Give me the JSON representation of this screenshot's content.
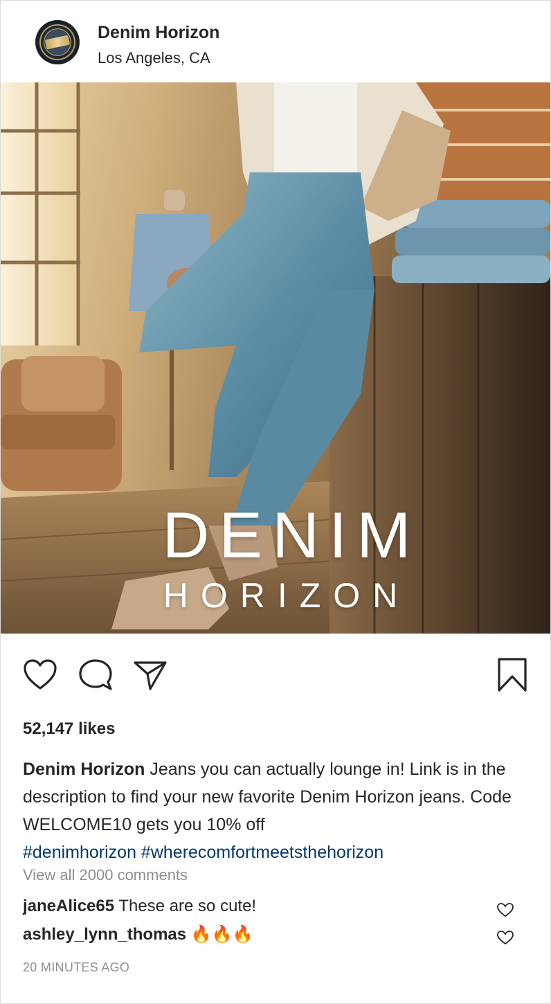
{
  "post": {
    "username": "Denim Horizon",
    "location": "Los Angeles, CA",
    "image": {
      "brand_line1": "DENIM",
      "brand_line2": "HORIZON"
    },
    "icons": [
      "heart-icon",
      "comment-icon",
      "share-icon",
      "bookmark-icon"
    ],
    "likes": "52,147 likes",
    "caption": {
      "username": "Denim Horizon",
      "text": " Jeans you can actually lounge in! Link is in the description to find your new favorite Denim Horizon jeans. Code WELCOME10 gets you 10% off",
      "hashtags": "#denimhorizon #wherecomfortmeetsthehorizon"
    },
    "view_all_comments": "View all 2000 comments",
    "comments": [
      {
        "username": "janeAlice65",
        "text": " These are so cute!"
      },
      {
        "username": "ashley_lynn_thomas",
        "text": " 🔥🔥🔥"
      }
    ],
    "timestamp": "20 MINUTES AGO"
  },
  "colors": {
    "text": "#262626",
    "muted": "#8e8e8e",
    "hashtag": "#00376b",
    "border": "#dbdbdb"
  }
}
